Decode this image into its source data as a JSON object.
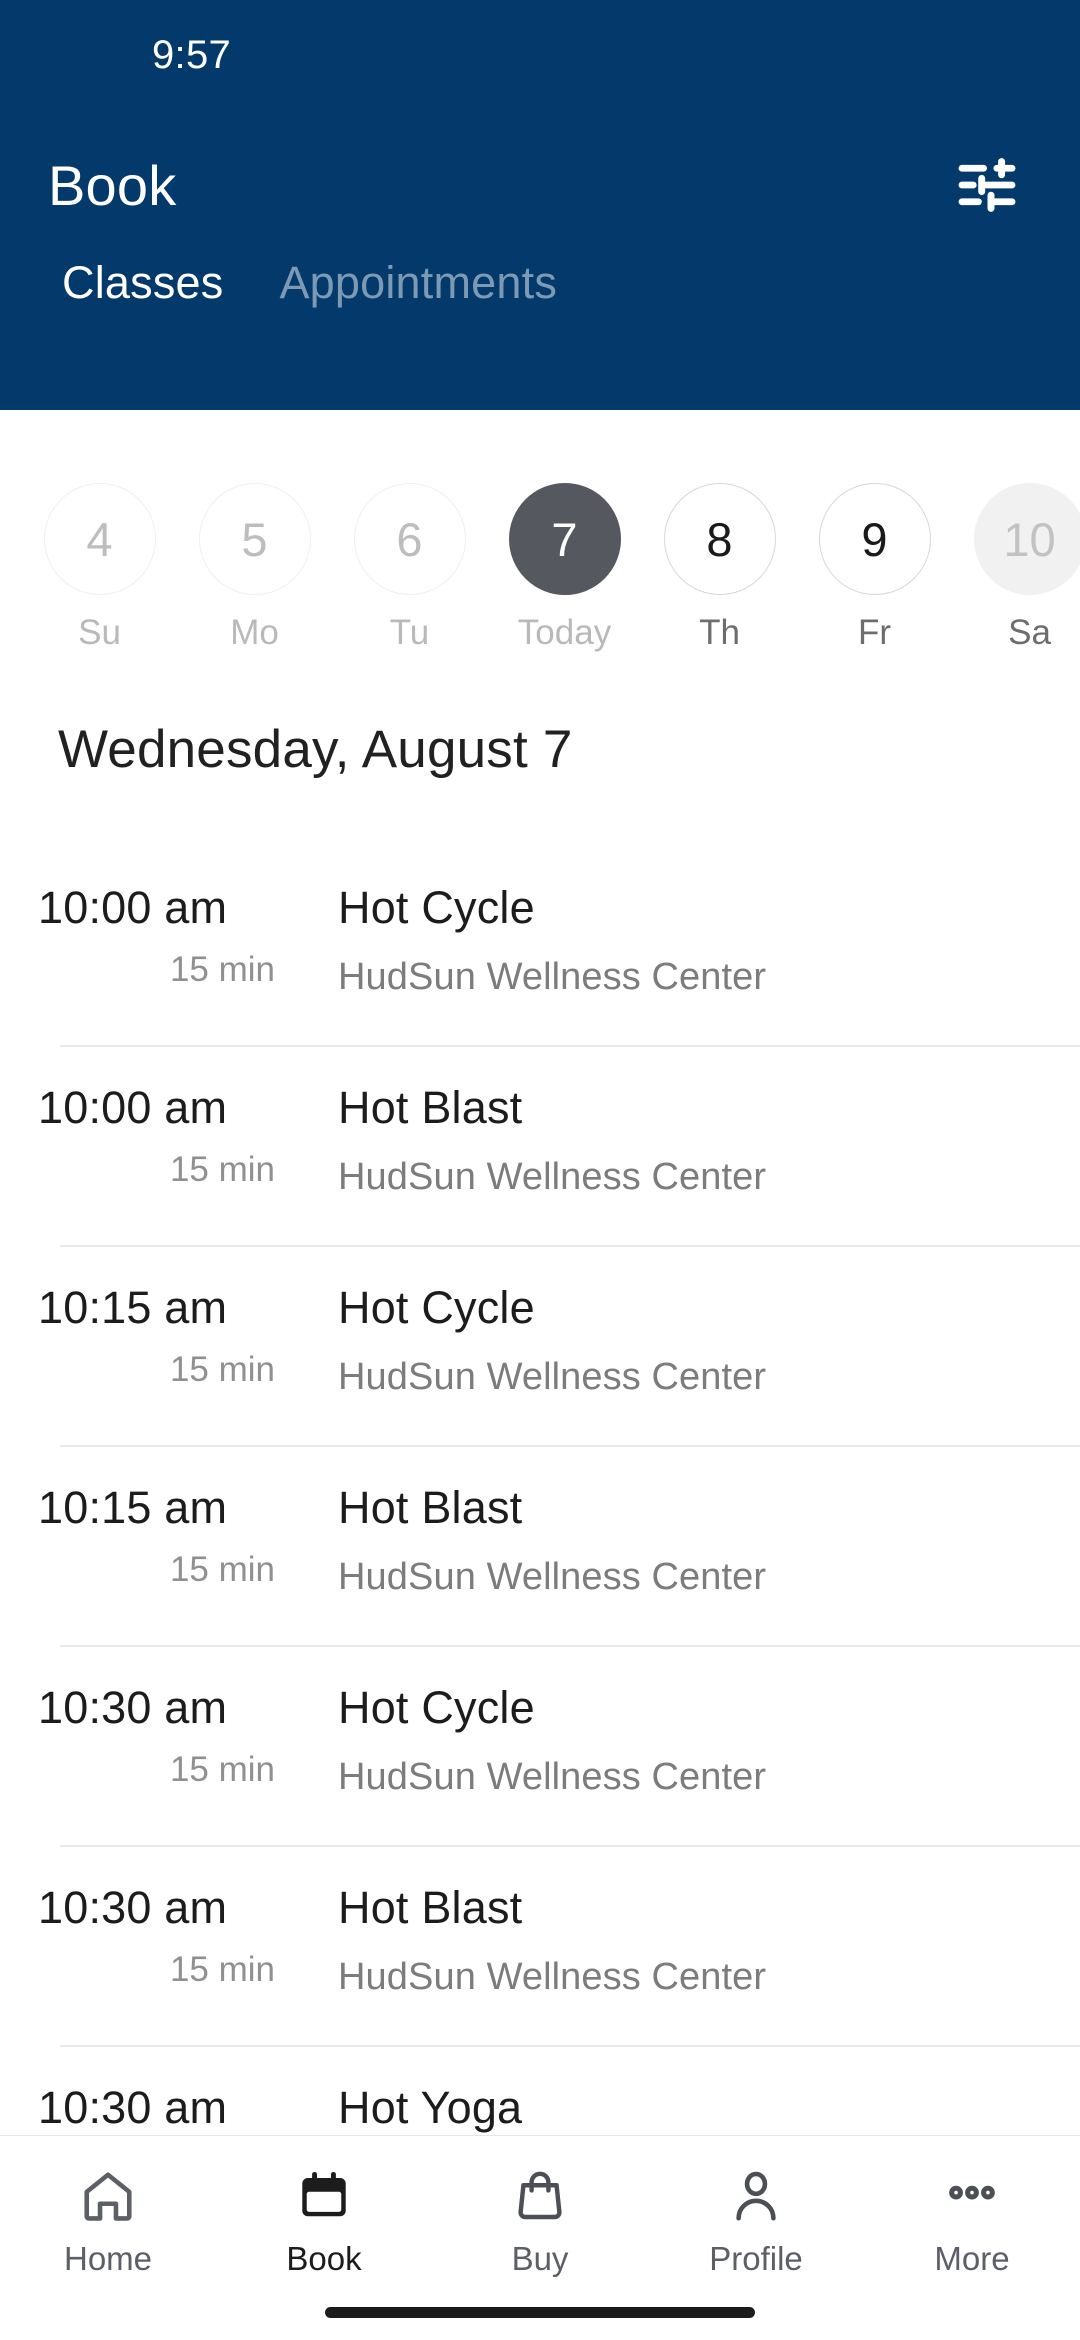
{
  "status_bar": {
    "time": "9:57"
  },
  "header": {
    "title": "Book",
    "filter_icon": "sliders-filter-icon",
    "accent_color": "#04396b",
    "tabs": [
      {
        "label": "Classes",
        "active": true
      },
      {
        "label": "Appointments",
        "active": false
      }
    ]
  },
  "date_strip": {
    "selected_color": "#55585f",
    "days": [
      {
        "number": "4",
        "label": "Su",
        "state": "past"
      },
      {
        "number": "5",
        "label": "Mo",
        "state": "past"
      },
      {
        "number": "6",
        "label": "Tu",
        "state": "past"
      },
      {
        "number": "7",
        "label": "Today",
        "state": "today"
      },
      {
        "number": "8",
        "label": "Th",
        "state": "future"
      },
      {
        "number": "9",
        "label": "Fr",
        "state": "future"
      },
      {
        "number": "10",
        "label": "Sa",
        "state": "filled"
      }
    ]
  },
  "main": {
    "date_heading": "Wednesday, August 7",
    "classes": [
      {
        "time": "10:00 am",
        "duration": "15 min",
        "name": "Hot Cycle",
        "location": "HudSun Wellness Center"
      },
      {
        "time": "10:00 am",
        "duration": "15 min",
        "name": "Hot Blast",
        "location": "HudSun Wellness Center"
      },
      {
        "time": "10:15 am",
        "duration": "15 min",
        "name": "Hot Cycle",
        "location": "HudSun Wellness Center"
      },
      {
        "time": "10:15 am",
        "duration": "15 min",
        "name": "Hot Blast",
        "location": "HudSun Wellness Center"
      },
      {
        "time": "10:30 am",
        "duration": "15 min",
        "name": "Hot Cycle",
        "location": "HudSun Wellness Center"
      },
      {
        "time": "10:30 am",
        "duration": "15 min",
        "name": "Hot Blast",
        "location": "HudSun Wellness Center"
      },
      {
        "time": "10:30 am",
        "duration": "",
        "name": "Hot Yoga",
        "location": ""
      }
    ]
  },
  "bottom_nav": {
    "items": [
      {
        "label": "Home",
        "icon": "home-icon",
        "active": false
      },
      {
        "label": "Book",
        "icon": "calendar-icon",
        "active": true
      },
      {
        "label": "Buy",
        "icon": "shopping-bag-icon",
        "active": false
      },
      {
        "label": "Profile",
        "icon": "person-icon",
        "active": false
      },
      {
        "label": "More",
        "icon": "ellipsis-icon",
        "active": false
      }
    ]
  }
}
